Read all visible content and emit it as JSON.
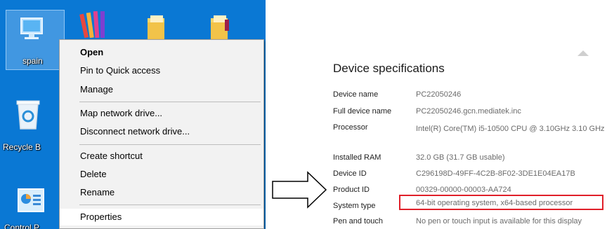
{
  "desktop": {
    "icons": [
      {
        "name": "this-pc",
        "label": "spain"
      },
      {
        "name": "recycle-bin",
        "label": "Recycle B"
      },
      {
        "name": "control-panel",
        "label": "Control P"
      }
    ]
  },
  "context_menu": {
    "items": [
      {
        "label": "Open"
      },
      {
        "label": "Pin to Quick access"
      },
      {
        "label": "Manage"
      },
      {
        "label": "Map network drive..."
      },
      {
        "label": "Disconnect network drive..."
      },
      {
        "label": "Create shortcut"
      },
      {
        "label": "Delete"
      },
      {
        "label": "Rename"
      },
      {
        "label": "Properties"
      }
    ]
  },
  "device_specs": {
    "title": "Device specifications",
    "rows": [
      {
        "label": "Device name",
        "value": "PC22050246"
      },
      {
        "label": "Full device name",
        "value": "PC22050246.gcn.mediatek.inc"
      },
      {
        "label": "Processor",
        "value": "Intel(R) Core(TM) i5-10500 CPU @ 3.10GHz   3.10 GHz"
      },
      {
        "label": "Installed RAM",
        "value": "32.0 GB (31.7 GB usable)"
      },
      {
        "label": "Device ID",
        "value": "C296198D-49FF-4C2B-8F02-3DE1E04EA17B"
      },
      {
        "label": "Product ID",
        "value": "00329-00000-00003-AA724"
      },
      {
        "label": "System type",
        "value": "64-bit operating system, x64-based processor"
      },
      {
        "label": "Pen and touch",
        "value": "No pen or touch input is available for this display"
      }
    ]
  },
  "colors": {
    "desktop_bg": "#0a78d4",
    "highlight_border": "#e0202a"
  }
}
